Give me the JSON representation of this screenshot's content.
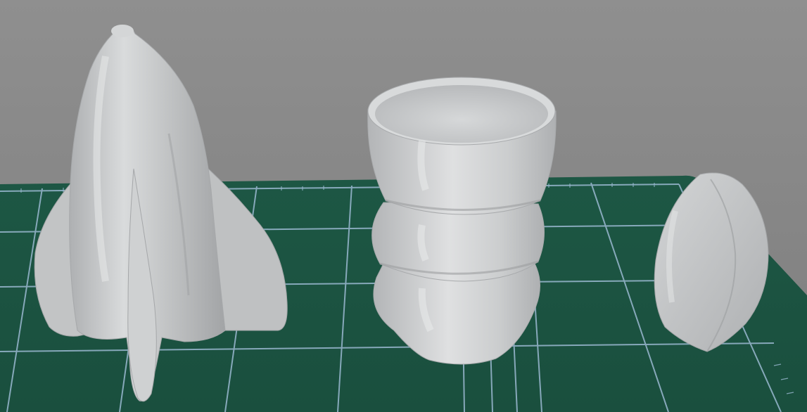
{
  "scene": {
    "background_color": "#8a8a8a",
    "mat_color": "#1f5a45",
    "mat_grid_color": "#8fb3cc",
    "model_color": "#c9cbcc",
    "objects": [
      {
        "name": "rocket-model"
      },
      {
        "name": "ribbed-cup-model"
      },
      {
        "name": "shell-piece-model"
      }
    ]
  }
}
